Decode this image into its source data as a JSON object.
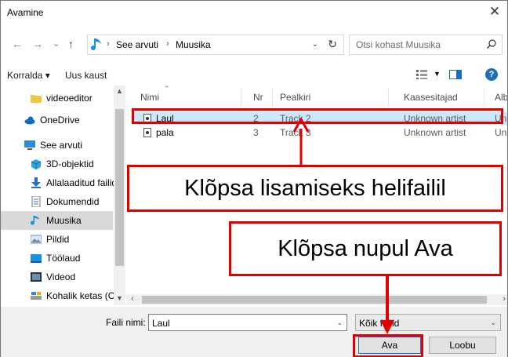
{
  "window": {
    "title": "Avamine",
    "close_symbol": "✕"
  },
  "nav": {
    "back": "←",
    "forward": "→",
    "recent": "⌄",
    "up": "↑"
  },
  "address": {
    "crumbs": [
      "See arvuti",
      "Muusika"
    ],
    "separator": "›",
    "refresh": "↻"
  },
  "search": {
    "placeholder": "Otsi kohast Muusika"
  },
  "toolbar": {
    "organize": "Korralda ▾",
    "new_folder": "Uus kaust"
  },
  "navpane": {
    "items": [
      {
        "label": "videoeditor",
        "icon": "folder-icon"
      },
      {
        "label": "OneDrive",
        "icon": "cloud-icon"
      },
      {
        "label": "See arvuti",
        "icon": "computer-icon"
      },
      {
        "label": "3D-objektid",
        "icon": "cube-icon"
      },
      {
        "label": "Allalaaditud failid",
        "icon": "download-icon"
      },
      {
        "label": "Dokumendid",
        "icon": "document-icon"
      },
      {
        "label": "Muusika",
        "icon": "music-icon"
      },
      {
        "label": "Pildid",
        "icon": "pictures-icon"
      },
      {
        "label": "Töölaud",
        "icon": "desktop-icon"
      },
      {
        "label": "Videod",
        "icon": "video-icon"
      },
      {
        "label": "Kohalik ketas (C:)",
        "icon": "drive-icon"
      }
    ],
    "selected": "Muusika"
  },
  "columns": [
    "Nimi",
    "Nr",
    "Pealkiri",
    "Kaasesitajad",
    "Alb"
  ],
  "files": [
    {
      "name": "Laul",
      "nr": "2",
      "title": "Track 2",
      "artist": "Unknown artist",
      "album": "Unk"
    },
    {
      "name": "pala",
      "nr": "3",
      "title": "Track 3",
      "artist": "Unknown artist",
      "album": "Unk"
    }
  ],
  "bottom": {
    "filename_label": "Faili nimi:",
    "filename_value": "Laul",
    "filter_value": "Kõik failid",
    "open_button": "Ava",
    "cancel_button": "Loobu"
  },
  "annotations": {
    "callout_file": "Klõpsa lisamiseks helifailil",
    "callout_open": "Klõpsa nupul Ava",
    "accent": "#e00000"
  },
  "colors": {
    "selection": "#cce8ff",
    "nav_selected": "#d9d9d9",
    "accent_blue": "#0078d7"
  }
}
